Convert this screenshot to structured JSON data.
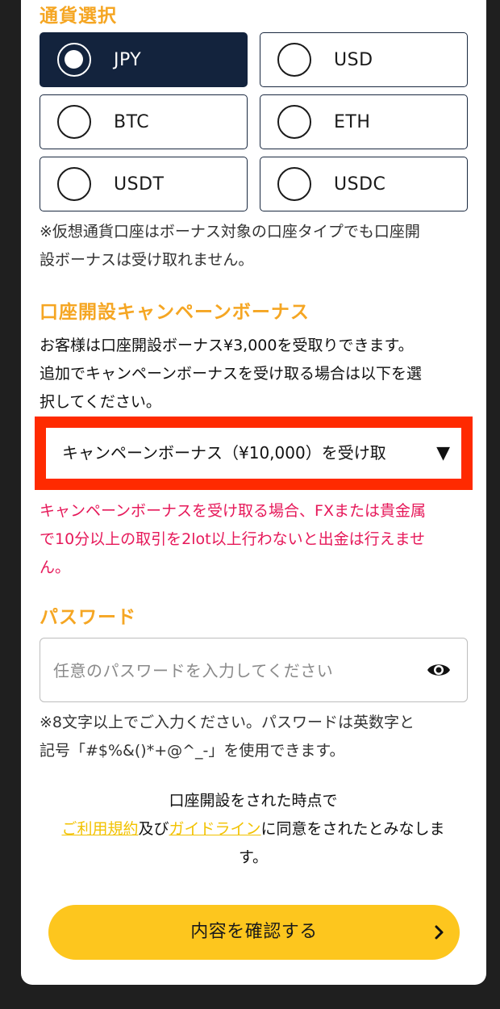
{
  "currency": {
    "title": "通貨選択",
    "options": [
      {
        "label": "JPY",
        "selected": true
      },
      {
        "label": "USD",
        "selected": false
      },
      {
        "label": "BTC",
        "selected": false
      },
      {
        "label": "ETH",
        "selected": false
      },
      {
        "label": "USDT",
        "selected": false
      },
      {
        "label": "USDC",
        "selected": false
      }
    ],
    "note_line1": "※仮想通貨口座はボーナス対象の口座タイプでも口座開",
    "note_line2": "設ボーナスは受け取れません。"
  },
  "campaign": {
    "title": "口座開設キャンペーンボーナス",
    "desc_line1": "お客様は口座開設ボーナス¥3,000を受取りできます。",
    "desc_line2": "追加でキャンペーンボーナスを受け取る場合は以下を選",
    "desc_line3": "択してください。",
    "select_value": "キャンペーンボーナス（¥10,000）を受け取",
    "select_arrow": "▼",
    "warning_line1": "キャンペーンボーナスを受け取る場合、FXまたは貴金属",
    "warning_line2": "で10分以上の取引を2lot以上行わないと出金は行えませ",
    "warning_line3": "ん。"
  },
  "password": {
    "title": "パスワード",
    "placeholder": "任意のパスワードを入力してください",
    "note_line1": "※8文字以上でご入力ください。パスワードは英数字と",
    "note_line2": "記号「#$%&()*+@^_-」を使用できます。"
  },
  "terms": {
    "line1": "口座開設をされた時点で",
    "link_terms": "ご利用規約",
    "and": "及び",
    "link_guideline": "ガイドライン",
    "suffix": "に同意をされたとみなしま",
    "line3": "す。"
  },
  "submit": {
    "label": "内容を確認する"
  },
  "colors": {
    "accent": "#f5a623",
    "selected_bg": "#13233d",
    "warning": "#e6195a",
    "highlight": "#ff2a00",
    "button": "#fdc61e",
    "link": "#f2c200"
  }
}
